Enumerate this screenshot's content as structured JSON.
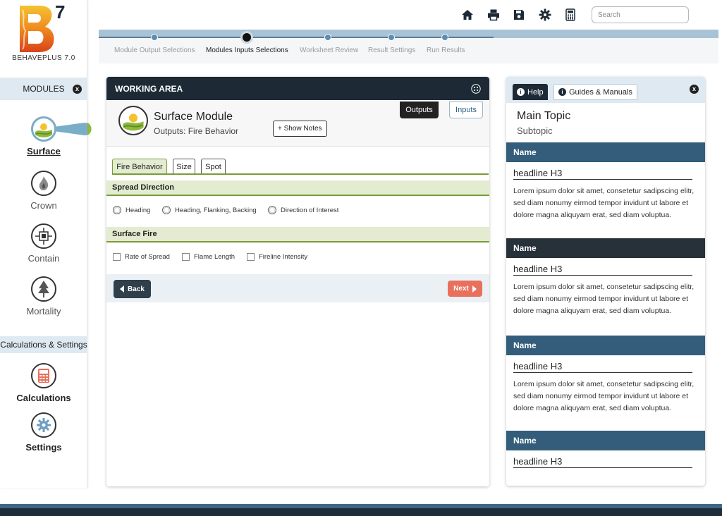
{
  "app": {
    "logo_letter": "B",
    "logo_version": "7",
    "name": "BEHAVEPLUS 7.0"
  },
  "toolbar": {
    "icons": [
      "home-icon",
      "print-icon",
      "save-icon",
      "gear-icon",
      "calculator-icon"
    ],
    "search_placeholder": "Search"
  },
  "stepper": {
    "steps": [
      {
        "label": "Module Output Selections",
        "state": "done"
      },
      {
        "label": "Modules Inputs Selections",
        "state": "current"
      },
      {
        "label": "Worksheet Review",
        "state": "todo"
      },
      {
        "label": "Result Settings",
        "state": "todo"
      },
      {
        "label": "Run Results",
        "state": "todo"
      }
    ]
  },
  "sidebar": {
    "modules_header": "MODULES",
    "close_glyph": "x",
    "modules": [
      {
        "label": "Surface",
        "icon": "surface-landscape-icon",
        "active": true
      },
      {
        "label": "Crown",
        "icon": "flame-icon",
        "active": false
      },
      {
        "label": "Contain",
        "icon": "contain-target-icon",
        "active": false
      },
      {
        "label": "Mortality",
        "icon": "tree-icon",
        "active": false
      }
    ],
    "calc_header": "Calculations & Settings",
    "tools": [
      {
        "label": "Calculations",
        "icon": "calculator-icon"
      },
      {
        "label": "Settings",
        "icon": "gear-icon"
      }
    ]
  },
  "working_area": {
    "title": "WORKING AREA",
    "module_title": "Surface Module",
    "module_subtitle": "Outputs: Fire Behavior",
    "show_notes": "+ Show Notes",
    "outputs_btn": "Outputs",
    "inputs_btn": "Inputs",
    "tabs": [
      "Fire Behavior",
      "Size",
      "Spot"
    ],
    "sections": [
      {
        "title": "Spread Direction",
        "type": "radio",
        "options": [
          "Heading",
          "Heading, Flanking, Backing",
          "Direction of Interest"
        ]
      },
      {
        "title": "Surface Fire",
        "type": "checkbox",
        "options": [
          "Rate of Spread",
          "Flame Length",
          "Fireline Intensity"
        ]
      }
    ],
    "back_btn": "Back",
    "next_btn": "Next"
  },
  "help": {
    "tab_help": "Help",
    "tab_guides": "Guides & Manuals",
    "info_glyph": "i",
    "close_glyph": "x",
    "main_topic": "Main Topic",
    "subtopic": "Subtopic",
    "blocks": [
      {
        "name": "Name",
        "headline": "headline H3",
        "body": "Lorem ipsum dolor sit amet, consetetur sadipscing elitr, sed diam nonumy eirmod tempor invidunt ut labore et dolore magna aliquyam erat, sed diam voluptua.",
        "color": "#335d7a"
      },
      {
        "name": "Name",
        "headline": "headline H3",
        "body": "Lorem ipsum dolor sit amet, consetetur sadipscing elitr, sed diam nonumy eirmod tempor invidunt ut labore et dolore magna aliquyam erat, sed diam voluptua.",
        "color": "#27313a"
      },
      {
        "name": "Name",
        "headline": "headline H3",
        "body": "Lorem ipsum dolor sit amet, consetetur sadipscing elitr, sed diam nonumy eirmod tempor invidunt ut labore et dolore magna aliquyam erat, sed diam voluptua.",
        "color": "#335d7a"
      },
      {
        "name": "Name",
        "headline": "headline H3",
        "body": "",
        "color": "#335d7a"
      }
    ]
  },
  "colors": {
    "accent_green": "#7a9b37",
    "header_dark": "#1d2a36",
    "next_orange": "#e9705c",
    "step_blue": "#5b8db2"
  }
}
